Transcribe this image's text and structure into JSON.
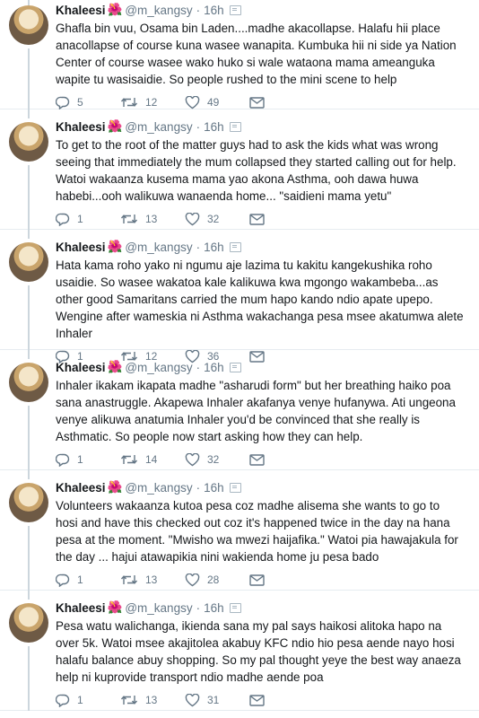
{
  "tweets": [
    {
      "name": "Khaleesi",
      "emoji": "🌺",
      "handle": "@m_kangsy",
      "time": "16h",
      "text": "Ghafla bin vuu, Osama bin Laden....madhe akacollapse. Halafu hii place anacollapse of course kuna wasee wanapita. Kumbuka hii ni side ya Nation Center of course wasee wako huko si wale wataona mama ameanguka wapite tu wasisaidie. So people rushed to the mini  scene to help",
      "replies": "5",
      "retweets": "12",
      "likes": "49"
    },
    {
      "name": "Khaleesi",
      "emoji": "🌺",
      "handle": "@m_kangsy",
      "time": "16h",
      "text": "To get to the root of the matter guys had to ask the kids what was wrong seeing that immediately the mum collapsed they started calling out for help. Watoi wakaanza kusema mama yao akona Asthma, ooh dawa huwa habebi...ooh walikuwa wanaenda home... \"saidieni mama yetu\"",
      "replies": "1",
      "retweets": "13",
      "likes": "32"
    },
    {
      "name": "Khaleesi",
      "emoji": "🌺",
      "handle": "@m_kangsy",
      "time": "16h",
      "text": "Hata kama roho yako ni ngumu aje lazima tu kakitu kangekushika roho usaidie. So wasee wakatoa kale kalikuwa kwa mgongo wakambeba...as other good Samaritans carried the mum hapo kando ndio apate upepo. Wengine after wameskia ni Asthma wakachanga pesa msee akatumwa alete Inhaler",
      "replies": "1",
      "retweets": "12",
      "likes": "36"
    },
    {
      "name": "Khaleesi",
      "emoji": "🌺",
      "handle": "@m_kangsy",
      "time": "16h",
      "text": "Inhaler ikakam ikapata madhe \"asharudi form\" but her breathing haiko poa sana anastruggle. Akapewa Inhaler akafanya venye hufanywa. Ati ungeona venye alikuwa anatumia Inhaler you'd be convinced that she really is Asthmatic. So people now start asking how they can help.",
      "replies": "1",
      "retweets": "14",
      "likes": "32"
    },
    {
      "name": "Khaleesi",
      "emoji": "🌺",
      "handle": "@m_kangsy",
      "time": "16h",
      "text": "Volunteers wakaanza kutoa pesa coz madhe alisema she wants to go to hosi and have this checked out coz it's happened twice in the day na hana pesa at the moment. \"Mwisho wa mwezi haijafika.\" Watoi pia hawajakula for the day ... hajui atawapikia nini wakienda home ju pesa bado",
      "replies": "1",
      "retweets": "13",
      "likes": "28"
    },
    {
      "name": "Khaleesi",
      "emoji": "🌺",
      "handle": "@m_kangsy",
      "time": "16h",
      "text": "Pesa watu walichanga, ikienda sana my pal says haikosi alitoka hapo na over 5k. Watoi msee akajitolea akabuy KFC ndio hio pesa aende nayo hosi halafu balance abuy shopping. So my pal thought yeye the best way anaeza help ni kuprovide transport ndio madhe aende poa",
      "replies": "1",
      "retweets": "13",
      "likes": "31"
    }
  ]
}
